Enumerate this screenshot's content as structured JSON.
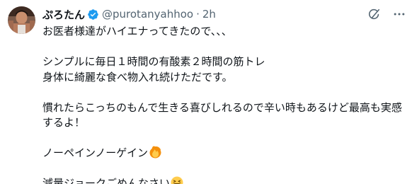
{
  "tweet": {
    "author": {
      "display_name": "ぷろたん",
      "handle": "@purotanyahhoo",
      "verified": true
    },
    "separator": "·",
    "timestamp": "2h",
    "lines": [
      "お医者様達がハイエナってきたので、、、",
      "",
      "シンプルに毎日１時間の有酸素２時間の筋トレ",
      "身体に綺麗な食べ物入れ続けただです。",
      "",
      "慣れたらこっちのもんで生きる喜びしれるので辛い時もあるけど最高も実感",
      "するよ！",
      "",
      "ノーペインノーゲイン",
      "",
      "減量ジョークごめんなさい"
    ],
    "emojis": {
      "fire": "fire-emoji",
      "laugh": "grinning-squinting-face-emoji"
    },
    "icons": {
      "grok": "grok-icon",
      "more": "more-horizontal-icon"
    },
    "colors": {
      "verified": "#1d9bf0",
      "muted": "#536471",
      "text": "#0f1419"
    }
  }
}
